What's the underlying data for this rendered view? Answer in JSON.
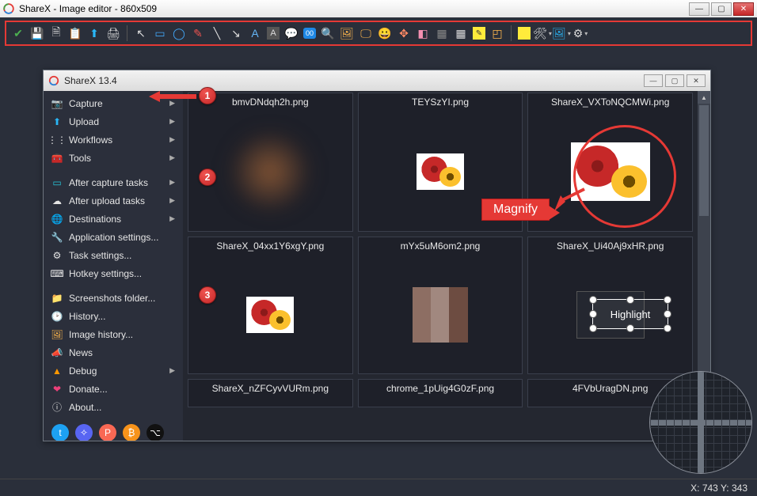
{
  "outer_window": {
    "title": "ShareX - Image editor - 860x509"
  },
  "inner_window": {
    "title": "ShareX 13.4"
  },
  "sidebar": {
    "capture": "Capture",
    "upload": "Upload",
    "workflows": "Workflows",
    "tools": "Tools",
    "after_capture": "After capture tasks",
    "after_upload": "After upload tasks",
    "destinations": "Destinations",
    "app_settings": "Application settings...",
    "task_settings": "Task settings...",
    "hotkey_settings": "Hotkey settings...",
    "screenshots_folder": "Screenshots folder...",
    "history": "History...",
    "image_history": "Image history...",
    "news": "News",
    "debug": "Debug",
    "donate": "Donate...",
    "about": "About..."
  },
  "thumbs": {
    "r1c1": "bmvDNdqh2h.png",
    "r1c2": "TEYSzYI.png",
    "r1c3": "ShareX_VXToNQCMWi.png",
    "r2c1": "ShareX_04xx1Y6xgY.png",
    "r2c2": "mYx5uM6om2.png",
    "r2c3": "ShareX_Ui40Aj9xHR.png",
    "r3c1": "ShareX_nZFCyvVURm.png",
    "r3c2": "chrome_1pUig4G0zF.png",
    "r3c3": "4FVbUragDN.png"
  },
  "annotations": {
    "magnify": "Magnify",
    "highlight": "Highlight",
    "step1": "1",
    "step2": "2",
    "step3": "3"
  },
  "status": {
    "coords": "X: 743 Y: 343"
  },
  "colors": {
    "accent_red": "#e53935"
  }
}
